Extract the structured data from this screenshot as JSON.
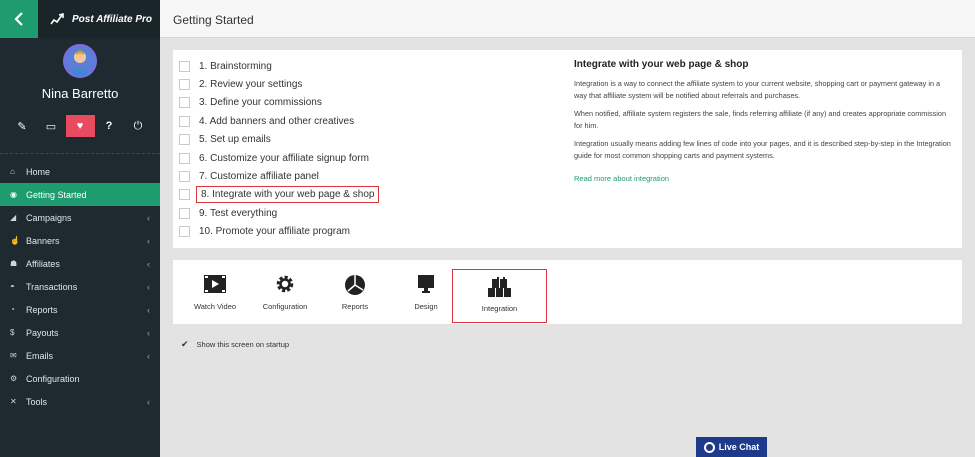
{
  "brand": {
    "name": "Post Affiliate Pro"
  },
  "user": {
    "name": "Nina Barretto"
  },
  "quick_icons": [
    "pencil-icon",
    "monitor-icon",
    "heart-icon",
    "help-icon",
    "power-icon"
  ],
  "menu": [
    {
      "label": "Home",
      "icon": "home-icon",
      "has_sub": false
    },
    {
      "label": "Getting Started",
      "icon": "rocket-icon",
      "has_sub": false,
      "active": true
    },
    {
      "label": "Campaigns",
      "icon": "megaphone-icon",
      "has_sub": true
    },
    {
      "label": "Banners",
      "icon": "hand-icon",
      "has_sub": true
    },
    {
      "label": "Affiliates",
      "icon": "users-icon",
      "has_sub": true
    },
    {
      "label": "Transactions",
      "icon": "basket-icon",
      "has_sub": true
    },
    {
      "label": "Reports",
      "icon": "dashboard-icon",
      "has_sub": true
    },
    {
      "label": "Payouts",
      "icon": "moneybag-icon",
      "has_sub": true
    },
    {
      "label": "Emails",
      "icon": "envelope-icon",
      "has_sub": true
    },
    {
      "label": "Configuration",
      "icon": "gear-icon",
      "has_sub": false
    },
    {
      "label": "Tools",
      "icon": "wrench-icon",
      "has_sub": true
    }
  ],
  "header": {
    "title": "Getting Started"
  },
  "checklist": [
    "1. Brainstorming",
    "2. Review your settings",
    "3. Define your commissions",
    "4. Add banners and other creatives",
    "5. Set up emails",
    "6. Customize your affiliate signup form",
    "7. Customize affiliate panel",
    "8. Integrate with your web page & shop",
    "9. Test everything",
    "10. Promote your affiliate program"
  ],
  "info": {
    "title": "Integrate with your web page & shop",
    "p1": "Integration is a way to connect the affiliate system to your current website, shopping cart or payment gateway in a way that affiliate system will be notified about referrals and purchases.",
    "p2": "When notified, affiliate system registers the sale, finds referring affiliate (if any) and creates appropriate commission for him.",
    "p3": "Integration usually means adding few lines of code into your pages, and it is described step-by-step in the Integration guide for most common shopping carts and payment systems.",
    "link": "Read more about integration"
  },
  "tools": {
    "watch_video": "Watch Video",
    "configuration": "Configuration",
    "reports": "Reports",
    "design": "Design",
    "integration": "Integration"
  },
  "startup": {
    "label": "Show this screen on startup",
    "checked": true
  },
  "livechat": {
    "label": "Live Chat"
  },
  "colors": {
    "sidebar": "#1e2a30",
    "accent": "#1f9b70",
    "highlight": "#d9363e",
    "quick_active": "#e84a5f",
    "chat": "#1e3a8a"
  }
}
